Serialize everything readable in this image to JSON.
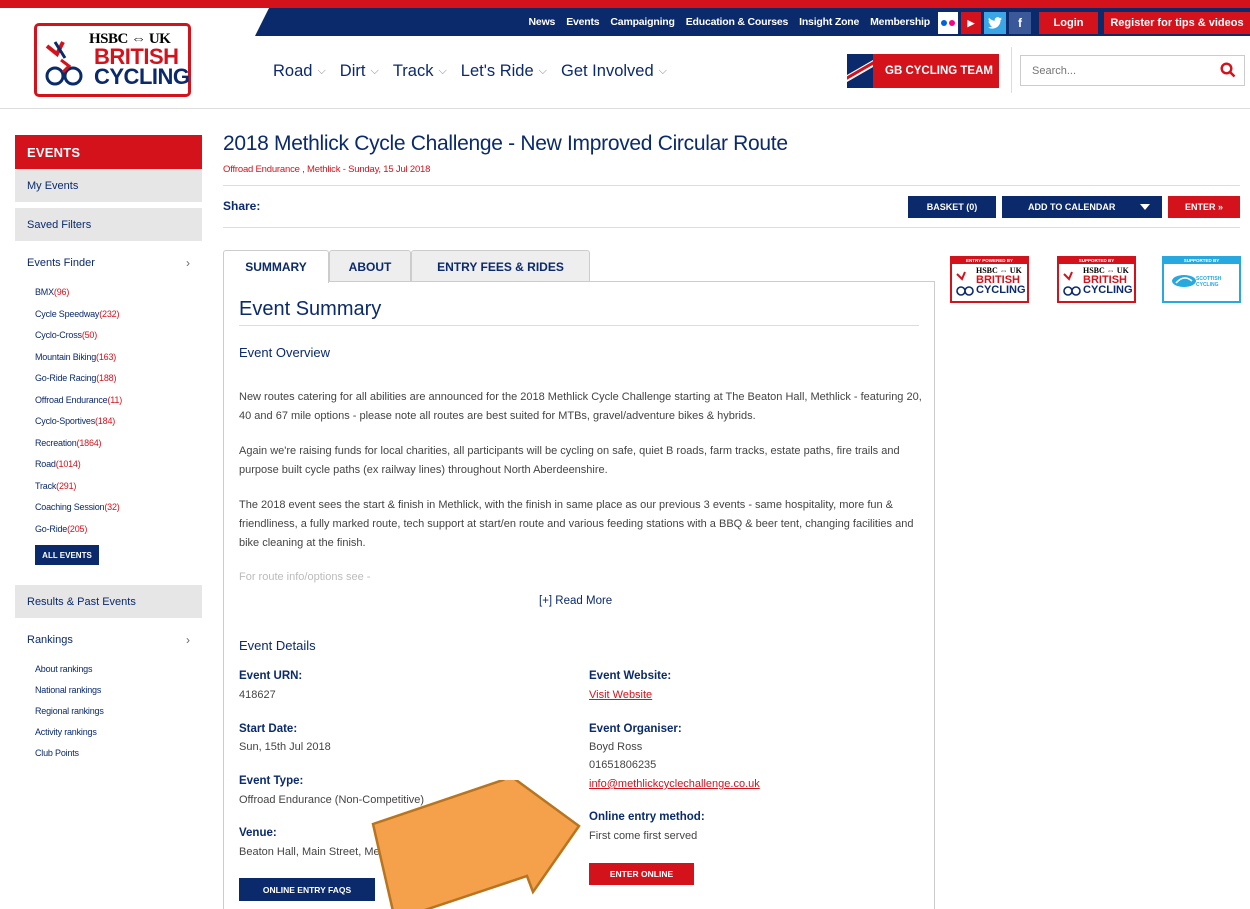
{
  "colors": {
    "brand_red": "#d4121c",
    "brand_navy": "#0b2a6b",
    "arrow_fill": "#f5a04a",
    "arrow_stroke": "#b8741e"
  },
  "logo": {
    "hsbc": "HSBC ⇔ UK",
    "line1": "BRITISH",
    "line2": "CYCLING"
  },
  "util_nav": {
    "links": [
      "News",
      "Events",
      "Campaigning",
      "Education & Courses",
      "Insight Zone",
      "Membership"
    ],
    "login": "Login",
    "register": "Register for tips & videos"
  },
  "main_nav": {
    "items": [
      "Road",
      "Dirt",
      "Track",
      "Let's Ride",
      "Get Involved"
    ],
    "gb_team": "GB CYCLING TEAM",
    "search_placeholder": "Search..."
  },
  "sidebar": {
    "header": "EVENTS",
    "my_events": "My Events",
    "saved_filters": "Saved Filters",
    "events_finder": "Events Finder",
    "categories": [
      {
        "name": "BMX",
        "count": "(96)"
      },
      {
        "name": "Cycle Speedway",
        "count": "(232)"
      },
      {
        "name": "Cyclo-Cross",
        "count": "(50)"
      },
      {
        "name": "Mountain Biking",
        "count": "(163)"
      },
      {
        "name": "Go-Ride Racing",
        "count": "(188)"
      },
      {
        "name": "Offroad Endurance",
        "count": "(11)"
      },
      {
        "name": "Cyclo-Sportives",
        "count": "(184)"
      },
      {
        "name": "Recreation",
        "count": "(1864)"
      },
      {
        "name": "Road",
        "count": "(1014)"
      },
      {
        "name": "Track",
        "count": "(291)"
      },
      {
        "name": "Coaching Session",
        "count": "(32)"
      },
      {
        "name": "Go-Ride",
        "count": "(205)"
      }
    ],
    "all_events": "ALL EVENTS",
    "results": "Results & Past Events",
    "rankings": "Rankings",
    "ranking_links": [
      "About rankings",
      "National rankings",
      "Regional rankings",
      "Activity rankings",
      "Club Points"
    ]
  },
  "event": {
    "title": "2018 Methlick Cycle Challenge - New Improved Circular Route",
    "subtitle": "Offroad Endurance , Methlick - Sunday, 15 Jul 2018",
    "share": "Share:",
    "basket": "BASKET (0)",
    "add_to_calendar": "ADD TO CALENDAR",
    "enter": "ENTER »"
  },
  "tabs": [
    "SUMMARY",
    "ABOUT",
    "ENTRY FEES & RIDES"
  ],
  "summary": {
    "title": "Event Summary",
    "overview_heading": "Event Overview",
    "paragraphs": [
      "New routes catering for all abilities are announced for the 2018 Methlick Cycle Challenge starting at The Beaton Hall, Methlick - featuring 20, 40 and 67 mile options - please note all routes are best suited for MTBs, gravel/adventure bikes & hybrids.",
      "Again we're raising funds for local charities, all participants will be cycling on safe, quiet B roads, farm tracks, estate paths, fire trails and purpose built cycle paths (ex railway lines) throughout North Aberdeenshire.",
      "The 2018 event sees the start & finish in Methlick, with the finish in same place as our previous 3 events - same hospitality, more fun & friendliness, a fully marked route, tech support at start/en route and various feeding stations with a BBQ & beer tent, changing facilities and bike cleaning at the finish.",
      "For route info/options see -"
    ],
    "read_more": "[+] Read More",
    "details_heading": "Event Details"
  },
  "details": {
    "urn_label": "Event URN:",
    "urn": "418627",
    "start_label": "Start Date:",
    "start": "Sun, 15th Jul 2018",
    "type_label": "Event Type:",
    "type": "Offroad Endurance (Non-Competitive)",
    "venue_label": "Venue:",
    "venue": "Beaton Hall, Main Street, Methlick, AB41 7DS",
    "website_label": "Event Website:",
    "website": "Visit Website",
    "organiser_label": "Event Organiser:",
    "organiser": "Boyd Ross",
    "phone": "01651806235",
    "email": "info@methlickcyclechallenge.co.uk",
    "method_label": "Online entry method:",
    "method": "First come first served",
    "faq_button": "ONLINE ENTRY FAQS",
    "enter_online": "ENTER ONLINE"
  },
  "badges": [
    {
      "top": "ENTRY POWERED BY"
    },
    {
      "top": "SUPPORTED BY"
    },
    {
      "top": "SUPPORTED BY",
      "text": "SCOTTISH CYCLING"
    }
  ]
}
